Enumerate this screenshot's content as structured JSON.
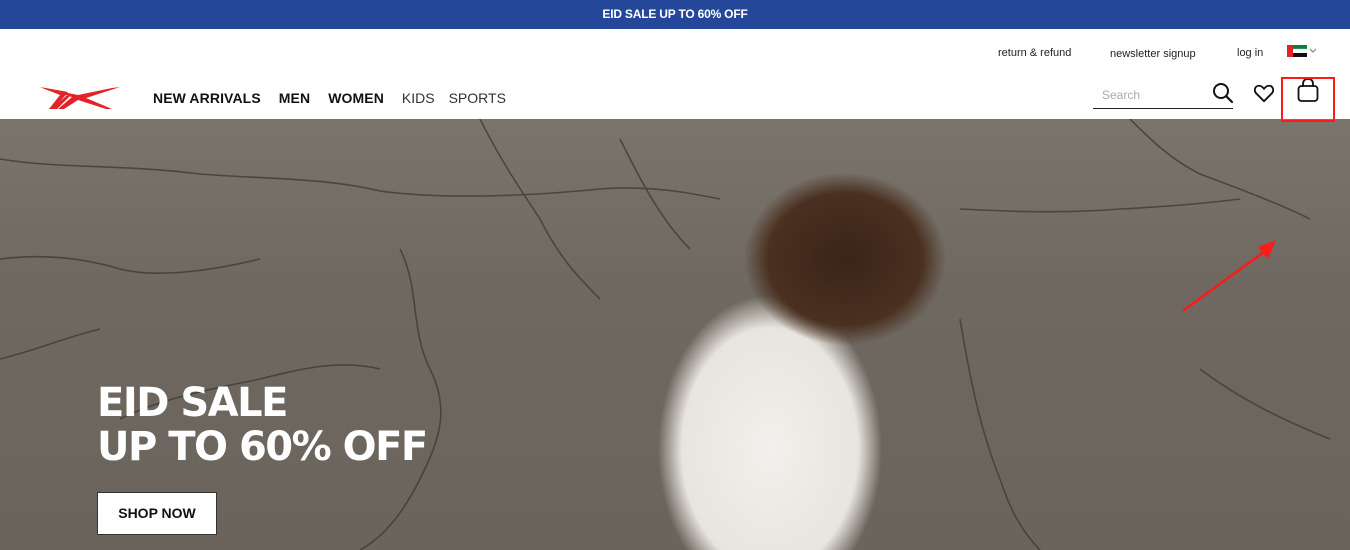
{
  "promo_bar": {
    "text": "EID SALE UP TO 60% OFF"
  },
  "header": {
    "utility_links": [
      {
        "label": "return & refund"
      },
      {
        "label": "newsletter signup"
      },
      {
        "label": "log in"
      }
    ],
    "country": {
      "flag": "uae-flag",
      "chevron": "⌄"
    },
    "nav": [
      {
        "label": "NEW ARRIVALS",
        "weight": "bold"
      },
      {
        "label": "MEN",
        "weight": "bold"
      },
      {
        "label": "WOMEN",
        "weight": "bold"
      },
      {
        "label": "KIDS",
        "weight": "light"
      },
      {
        "label": "SPORTS",
        "weight": "light"
      }
    ],
    "search": {
      "placeholder": "Search",
      "value": ""
    },
    "icons": [
      "search-icon",
      "heart-icon",
      "shopping-bag-icon"
    ]
  },
  "hero": {
    "title_line1": "EID SALE",
    "title_line2": "UP TO 60% OFF",
    "cta_label": "SHOP NOW"
  },
  "annotation": {
    "color": "#ff1a1a",
    "target": "shopping-bag-icon"
  },
  "colors": {
    "promo_bg": "#25479a",
    "brand_red": "#e4222a"
  }
}
